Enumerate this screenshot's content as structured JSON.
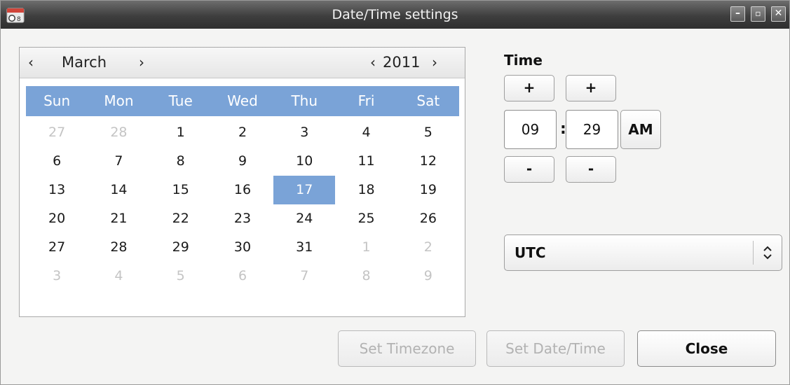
{
  "window": {
    "title": "Date/Time settings",
    "minimize_glyph": "–",
    "maximize_glyph": "▫",
    "close_glyph": "✕"
  },
  "calendar": {
    "prev_month_glyph": "‹",
    "next_month_glyph": "›",
    "month": "March",
    "prev_year_glyph": "‹",
    "next_year_glyph": "›",
    "year": "2011",
    "weekdays": [
      "Sun",
      "Mon",
      "Tue",
      "Wed",
      "Thu",
      "Fri",
      "Sat"
    ],
    "weeks": [
      [
        "27",
        "28",
        "1",
        "2",
        "3",
        "4",
        "5"
      ],
      [
        "6",
        "7",
        "8",
        "9",
        "10",
        "11",
        "12"
      ],
      [
        "13",
        "14",
        "15",
        "16",
        "17",
        "18",
        "19"
      ],
      [
        "20",
        "21",
        "22",
        "23",
        "24",
        "25",
        "26"
      ],
      [
        "27",
        "28",
        "29",
        "30",
        "31",
        "1",
        "2"
      ],
      [
        "3",
        "4",
        "5",
        "6",
        "7",
        "8",
        "9"
      ]
    ],
    "selected_day": "17",
    "accent_color": "#7aa3d7"
  },
  "time": {
    "label": "Time",
    "hour_increment": "+",
    "minute_increment": "+",
    "hour": "09",
    "separator": ":",
    "minute": "29",
    "period": "AM",
    "hour_decrement": "-",
    "minute_decrement": "-"
  },
  "timezone": {
    "value": "UTC"
  },
  "buttons": {
    "set_timezone": "Set Timezone",
    "set_datetime": "Set Date/Time",
    "close": "Close"
  }
}
